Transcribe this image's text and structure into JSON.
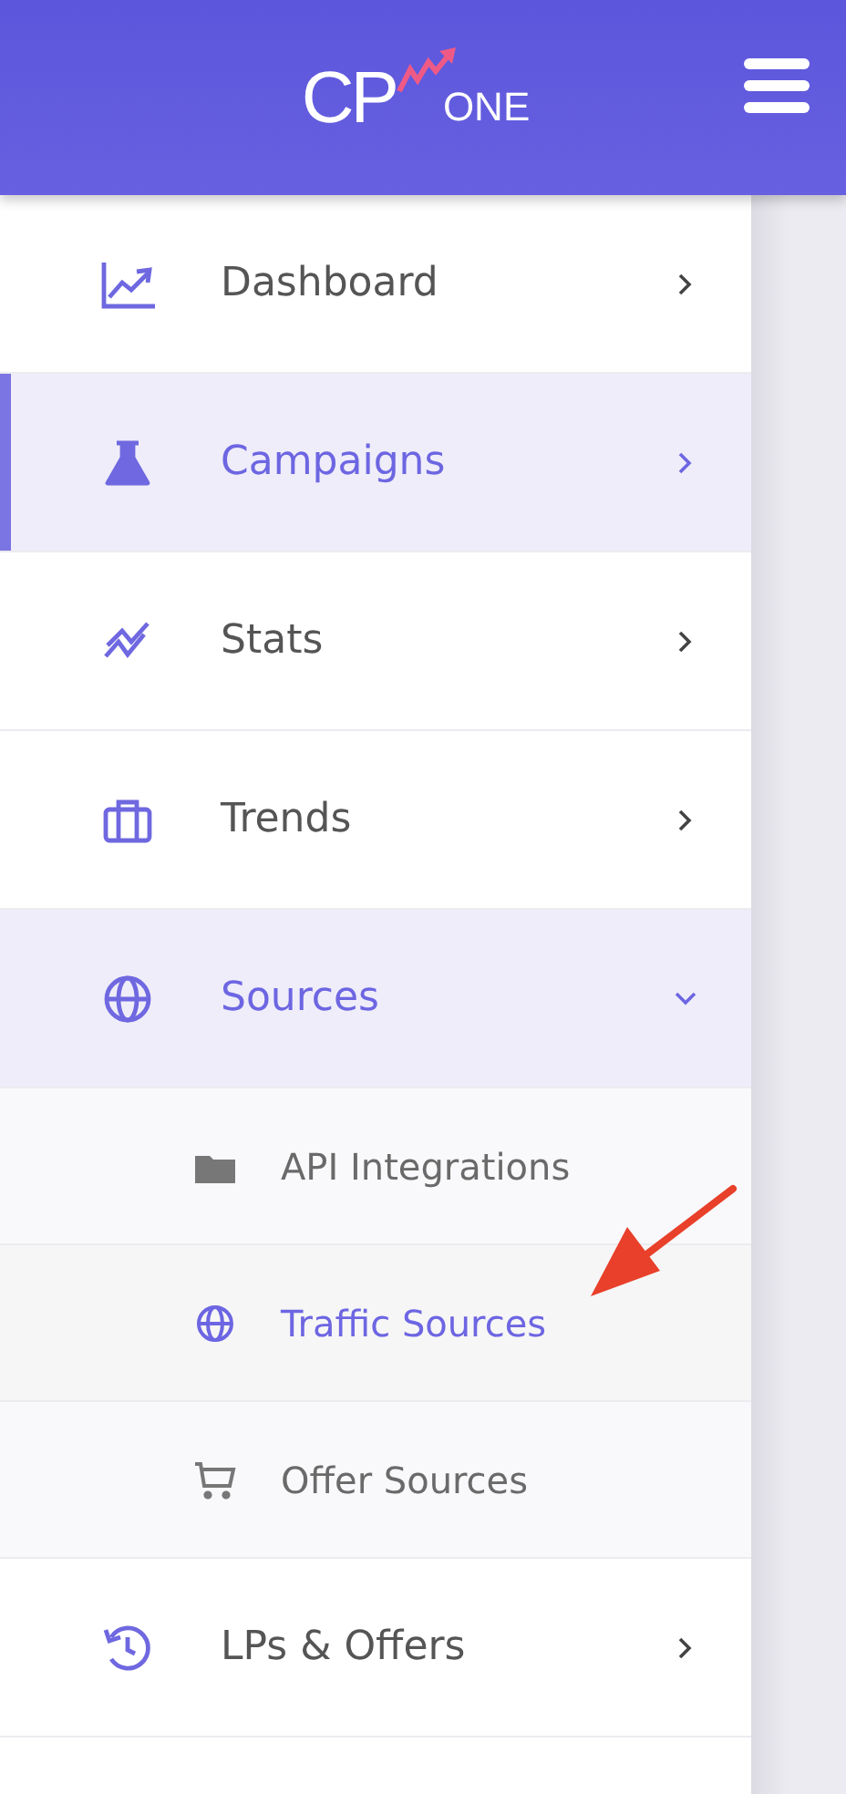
{
  "header": {
    "logo": {
      "initials": "CP",
      "word": "ONE"
    }
  },
  "menu": [
    {
      "label": "Dashboard",
      "selected": false,
      "expanded": false
    },
    {
      "label": "Campaigns",
      "selected": true,
      "expanded": false
    },
    {
      "label": "Stats",
      "selected": false,
      "expanded": false
    },
    {
      "label": "Trends",
      "selected": false,
      "expanded": false
    },
    {
      "label": "Sources",
      "selected": false,
      "expanded": true,
      "children": [
        {
          "label": "API Integrations",
          "selected": false
        },
        {
          "label": "Traffic Sources",
          "selected": true
        },
        {
          "label": "Offer Sources",
          "selected": false
        }
      ]
    },
    {
      "label": "LPs & Offers",
      "selected": false,
      "expanded": false
    }
  ]
}
